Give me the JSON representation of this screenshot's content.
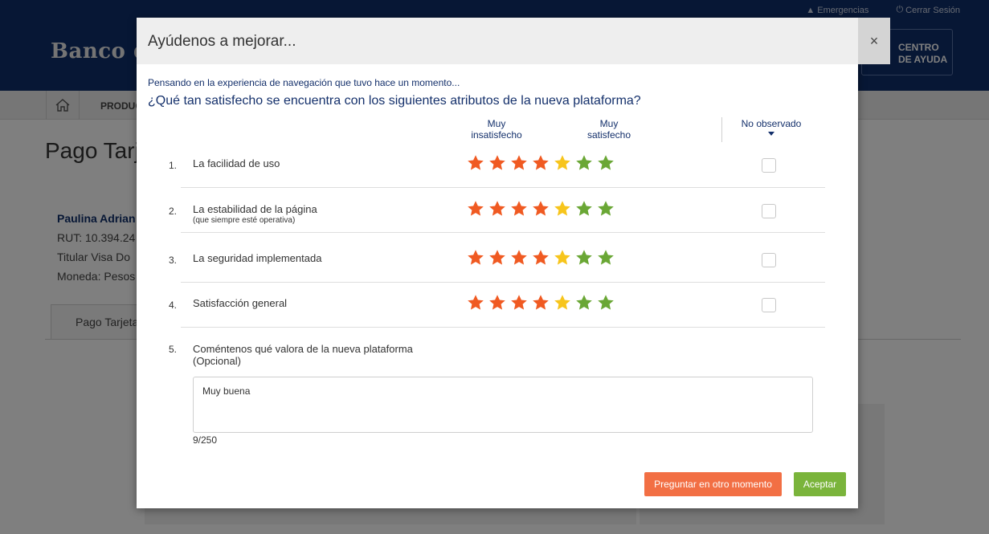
{
  "background": {
    "top_links": [
      "Emergencias",
      "Cerrar Sesión"
    ],
    "logo": "Banco de",
    "help_button": [
      "CENTRO",
      "DE AYUDA"
    ],
    "nav_item": "PRODUC",
    "page_title": "Pago Tarj",
    "customer": {
      "name": "Paulina Adrian",
      "rut": "RUT: 10.394.24",
      "holder": "Titular Visa Do",
      "currency": "Moneda: Pesos"
    },
    "tab": "Pago Tarjeta"
  },
  "modal": {
    "title": "Ayúdenos a mejorar...",
    "close": "×",
    "intro": "Pensando en la experiencia de navegación que tuvo hace un momento...",
    "question": "¿Qué tan satisfecho se encuentra con los siguientes atributos de la nueva plataforma?",
    "scale": {
      "low": [
        "Muy",
        "insatisfecho"
      ],
      "high": [
        "Muy",
        "satisfecho"
      ],
      "not_observed": "No observado"
    },
    "star_colors": [
      "#f05a22",
      "#f05a22",
      "#f05a22",
      "#f05a22",
      "#f7c51c",
      "#6aa735",
      "#6aa735"
    ],
    "items": [
      {
        "num": "1.",
        "label": "La facilidad de uso",
        "sub": "",
        "not_observed": false
      },
      {
        "num": "2.",
        "label": "La estabilidad de la página",
        "sub": "(que siempre esté operativa)",
        "not_observed": false
      },
      {
        "num": "3.",
        "label": "La seguridad implementada",
        "sub": "",
        "not_observed": false
      },
      {
        "num": "4.",
        "label": "Satisfacción general",
        "sub": "",
        "not_observed": false
      }
    ],
    "comment": {
      "num": "5.",
      "label": "Coméntenos qué valora de la nueva plataforma",
      "optional": "(Opcional)",
      "value": "Muy buena",
      "counter": "9/250"
    },
    "buttons": {
      "later": "Preguntar en otro momento",
      "accept": "Aceptar"
    }
  }
}
